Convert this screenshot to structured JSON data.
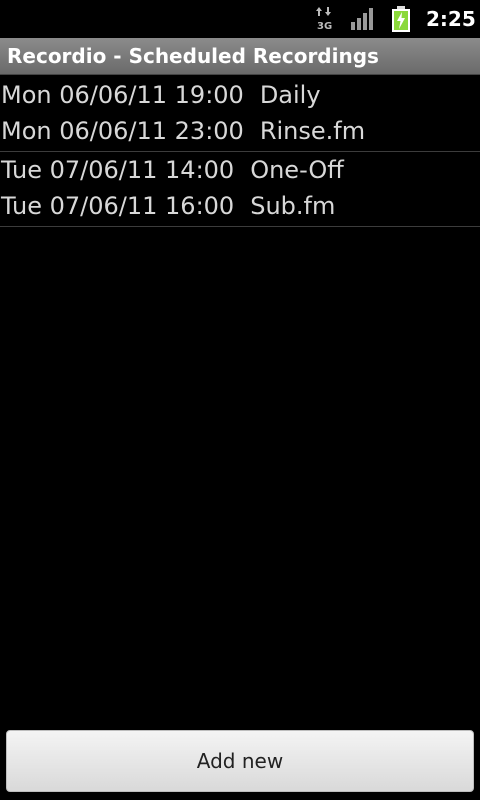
{
  "status_bar": {
    "network_label": "3G",
    "time": "2:25",
    "battery_color": "#8bd93a",
    "icons": [
      "network-3g-icon",
      "signal-strength-icon",
      "battery-charging-icon"
    ]
  },
  "app": {
    "title": "Recordio - Scheduled Recordings"
  },
  "recordings": [
    {
      "entries": [
        {
          "datetime": "Mon 06/06/11 19:00",
          "name": "Daily"
        },
        {
          "datetime": "Mon 06/06/11 23:00",
          "name": "Rinse.fm"
        }
      ]
    },
    {
      "entries": [
        {
          "datetime": "Tue 07/06/11 14:00",
          "name": "One-Off"
        },
        {
          "datetime": "Tue 07/06/11 16:00",
          "name": "Sub.fm"
        }
      ]
    }
  ],
  "add_button": {
    "label": "Add new"
  }
}
